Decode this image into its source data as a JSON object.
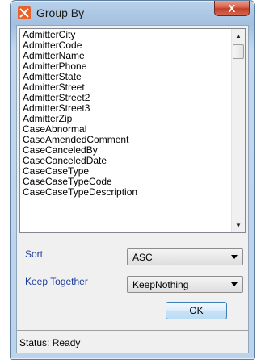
{
  "window": {
    "title": "Group By",
    "close_glyph": "X"
  },
  "fields": {
    "items": [
      "AdmitterCity",
      "AdmitterCode",
      "AdmitterName",
      "AdmitterPhone",
      "AdmitterState",
      "AdmitterStreet",
      "AdmitterStreet2",
      "AdmitterStreet3",
      "AdmitterZip",
      "CaseAbnormal",
      "CaseAmendedComment",
      "CaseCanceledBy",
      "CaseCanceledDate",
      "CaseCaseType",
      "CaseCaseTypeCode",
      "CaseCaseTypeDescription"
    ]
  },
  "sort": {
    "label": "Sort",
    "value": "ASC"
  },
  "keep_together": {
    "label": "Keep Together",
    "value": "KeepNothing"
  },
  "ok_label": "OK",
  "status": {
    "text": "Status: Ready"
  },
  "colors": {
    "label_blue": "#1f3d9b",
    "app_icon": "#e8622c",
    "close_red": "#c1402a"
  }
}
